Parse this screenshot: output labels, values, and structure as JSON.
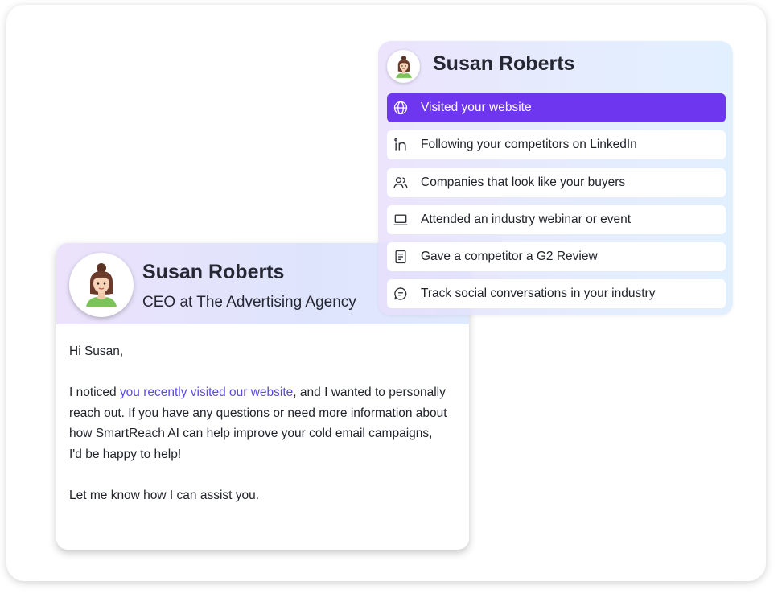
{
  "email": {
    "contact_name": "Susan Roberts",
    "contact_title": "CEO at The Advertising Agency",
    "greeting": "Hi Susan,",
    "paragraph1_before_link": "I noticed ",
    "paragraph1_link": "you recently visited our website",
    "paragraph1_after_link": ", and I wanted to personally reach out. If you have any questions or need more information about how SmartReach AI can help improve your cold email campaigns, I'd be happy to help!",
    "closing": "Let me know how I can assist you.",
    "link_color": "#5b4ae8"
  },
  "signals": {
    "contact_name": "Susan Roberts",
    "active_color": "#6f36ef",
    "items": [
      {
        "label": "Visited your website",
        "icon": "globe-icon",
        "active": true
      },
      {
        "label": "Following your competitors on LinkedIn",
        "icon": "linkedin-icon",
        "active": false
      },
      {
        "label": "Companies that look like your buyers",
        "icon": "users-icon",
        "active": false
      },
      {
        "label": "Attended an industry webinar or event",
        "icon": "laptop-icon",
        "active": false
      },
      {
        "label": "Gave a competitor a G2 Review",
        "icon": "document-icon",
        "active": false
      },
      {
        "label": "Track social conversations in your industry",
        "icon": "chat-bubble-icon",
        "active": false
      }
    ]
  }
}
